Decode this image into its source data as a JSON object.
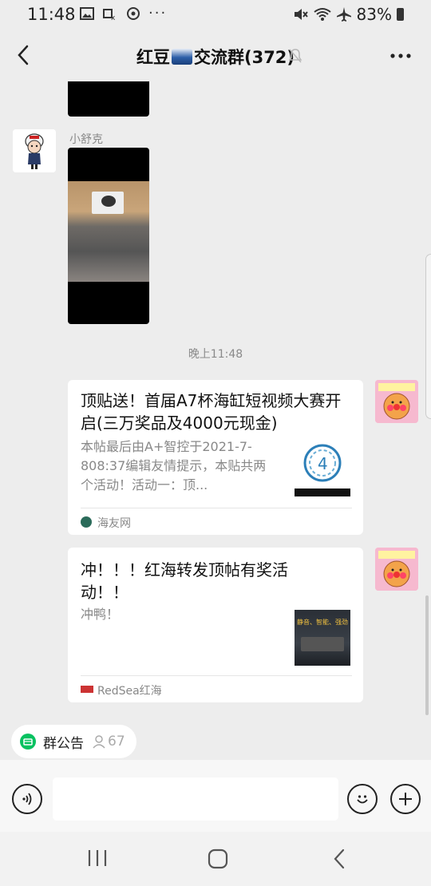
{
  "status_bar": {
    "time": "11:48",
    "battery": "83%",
    "icons": [
      "image-icon",
      "vpn-key-icon",
      "sync-icon",
      "more-dots-icon",
      "mute-icon",
      "wifi-icon",
      "airplane-icon",
      "battery-icon"
    ]
  },
  "header": {
    "title_prefix": "红豆",
    "title_suffix": "交流群(372)",
    "back_label": "<",
    "more_label": "..."
  },
  "chat": {
    "messages": [
      {
        "type": "image",
        "sender": "",
        "partial": true
      },
      {
        "type": "image",
        "sender": "小舒克"
      },
      {
        "type": "timestamp",
        "text": "晚上11:48"
      },
      {
        "type": "link_card",
        "title": "顶贴送！首届A7杯海缸短视频大赛开启(三万奖品及4000元现金)",
        "desc": "本帖最后由A+智控于2021-7-808:37编辑友情提示，本贴共两个活动！活动一：顶...",
        "source": "海友网"
      },
      {
        "type": "link_card",
        "title": "冲！！！红海转发顶帖有奖活动！！",
        "desc": "冲鸭！",
        "source": "RedSea红海",
        "thumb_text": "静音、智能、强劲"
      }
    ]
  },
  "notice": {
    "label": "群公告",
    "count": "67"
  },
  "input_bar": {
    "placeholder": ""
  },
  "colors": {
    "background": "#ededed",
    "accent_green": "#07c160",
    "card": "#ffffff"
  }
}
